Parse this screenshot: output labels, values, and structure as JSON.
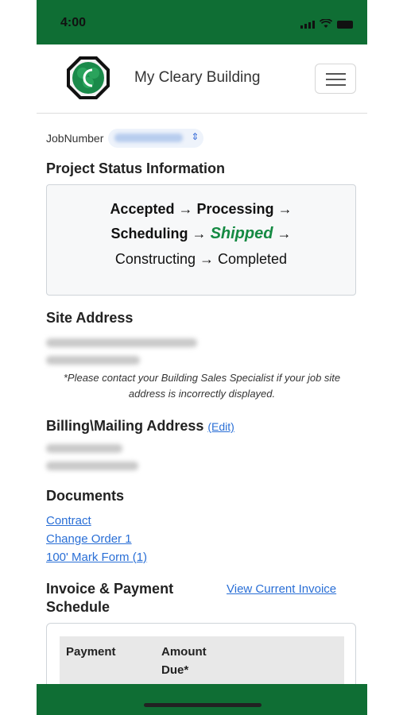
{
  "status_bar": {
    "time": "4:00"
  },
  "header": {
    "brand": "My Cleary Building",
    "menu_icon": "hamburger-icon"
  },
  "job": {
    "label": "JobNumber"
  },
  "project_status": {
    "heading": "Project Status Information",
    "steps": [
      "Accepted",
      "Processing",
      "Scheduling",
      "Shipped",
      "Constructing",
      "Completed"
    ],
    "arrow": "→",
    "current": "Shipped"
  },
  "site_address": {
    "heading": "Site Address",
    "note": "*Please contact your Building Sales Specialist if your job site address is incorrectly displayed."
  },
  "billing": {
    "heading": "Billing\\Mailing Address",
    "edit_label": "(Edit)"
  },
  "documents": {
    "heading": "Documents",
    "links": [
      "Contract",
      "Change Order 1",
      "100' Mark Form (1)"
    ]
  },
  "invoice": {
    "heading": "Invoice & Payment Schedule",
    "view_link": "View Current Invoice",
    "columns": [
      "Payment",
      "Amount Due*"
    ]
  },
  "colors": {
    "brand_green": "#0f6e34",
    "shipped_green": "#158a43",
    "link_blue": "#2a6fd6"
  }
}
